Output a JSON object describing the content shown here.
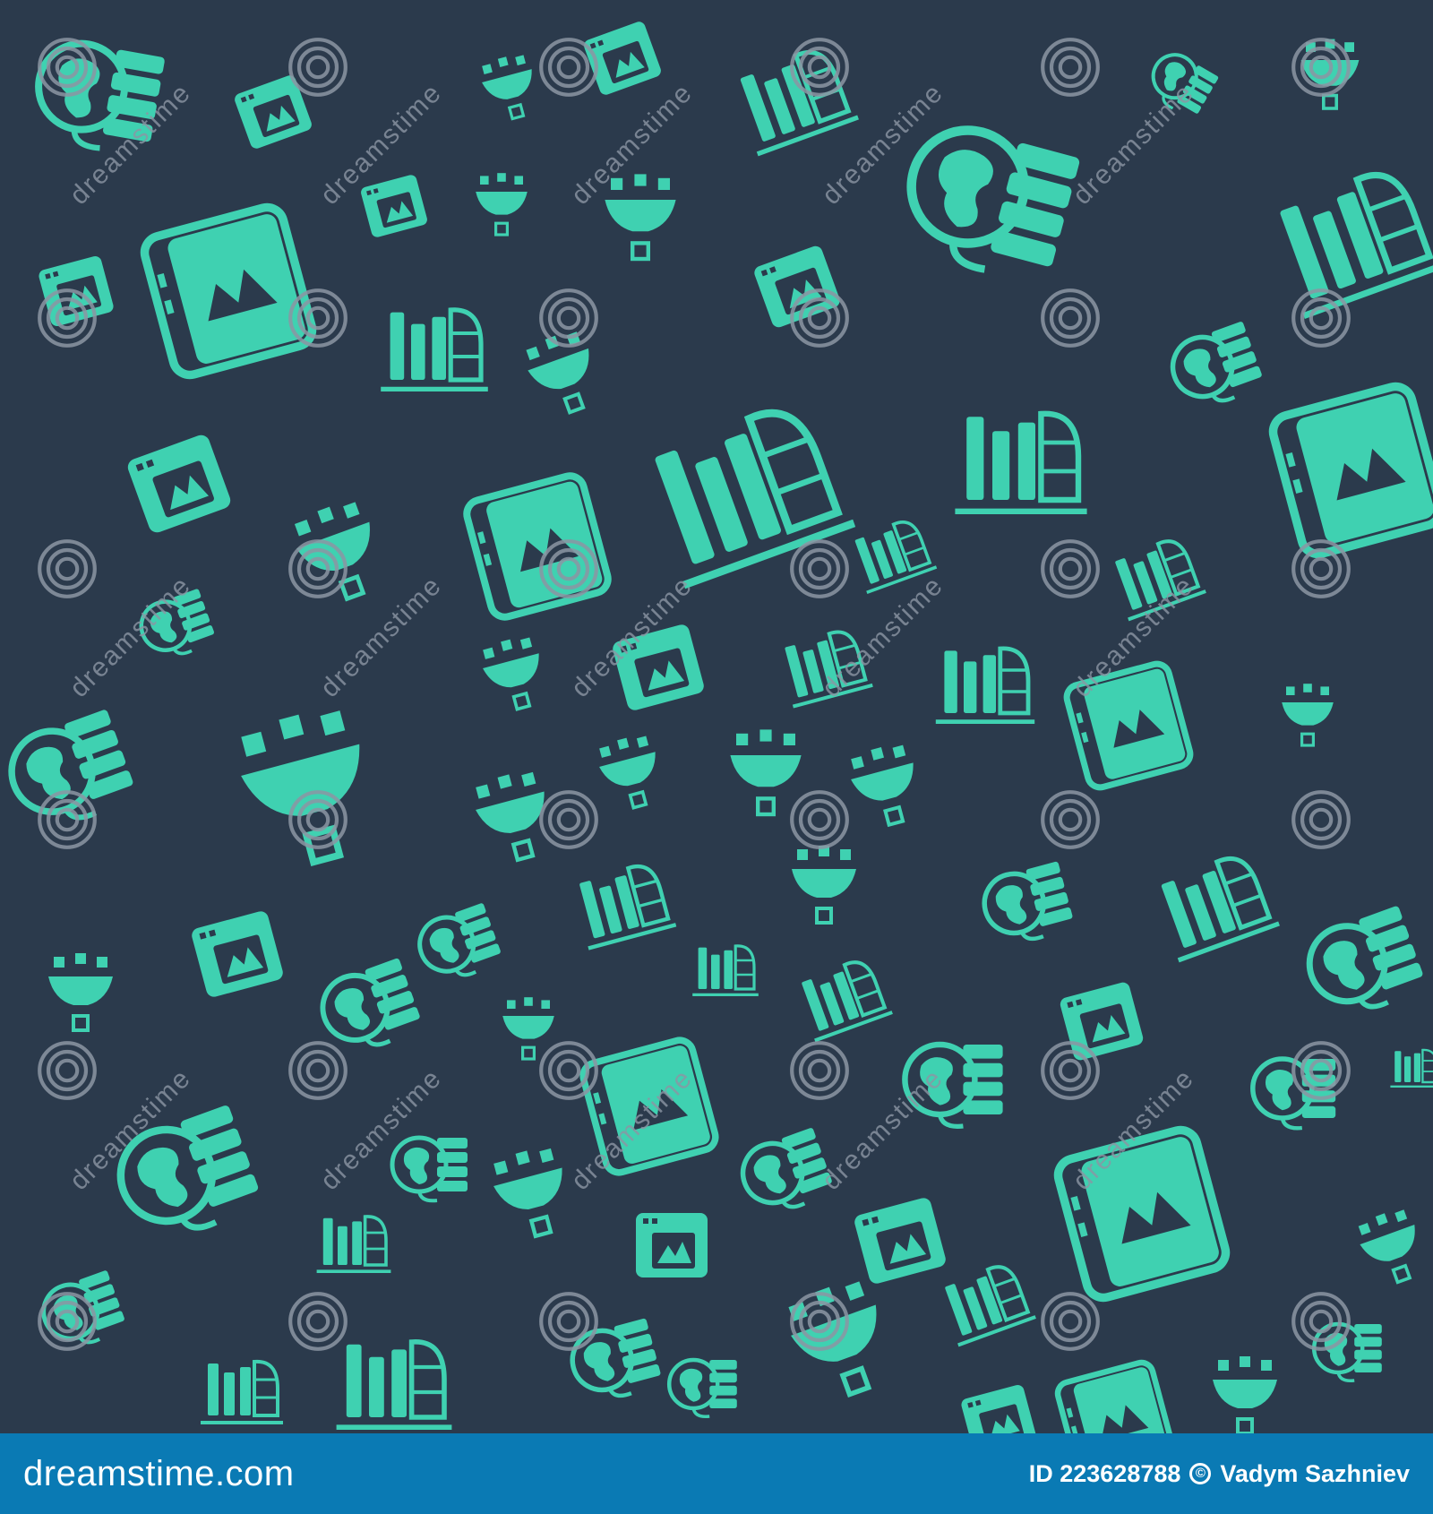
{
  "colors": {
    "background": "#2b3a4c",
    "icon": "#3fd1b1",
    "watermark": "#8c96a4",
    "footer_bg": "#0a7ab4",
    "footer_text": "#ffffff"
  },
  "watermark": {
    "text": "dreamstime",
    "icon": "dreamstime-spiral-icon"
  },
  "pattern_icons": [
    "globe-server-icon",
    "book-picture-icon",
    "bar-chart-icon",
    "funnel-icon",
    "window-picture-icon"
  ],
  "footer": {
    "brand": "dreamstime.com",
    "id_label": "ID 223628788",
    "copyright_symbol": "©",
    "author": "Vadym Sazhniev"
  }
}
